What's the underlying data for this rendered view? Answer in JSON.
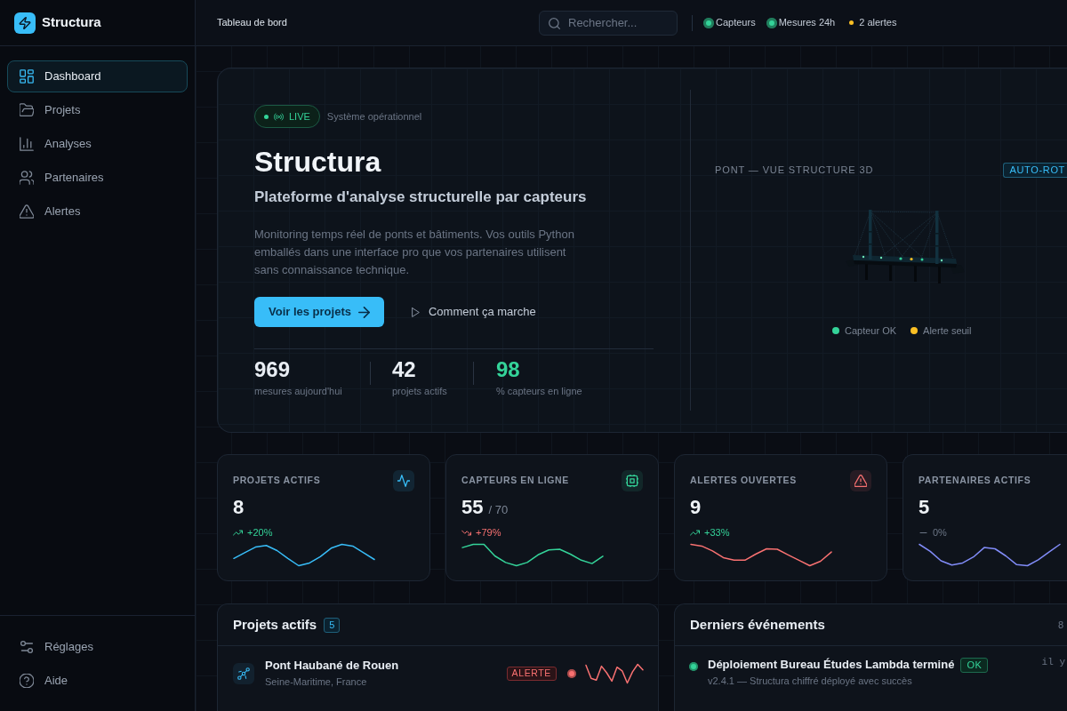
{
  "app": {
    "name": "Structura"
  },
  "sidebar": {
    "items": [
      {
        "label": "Dashboard",
        "selected": true
      },
      {
        "label": "Projets",
        "selected": false
      },
      {
        "label": "Analyses",
        "selected": false
      },
      {
        "label": "Partenaires",
        "selected": false
      },
      {
        "label": "Alertes",
        "selected": false
      }
    ],
    "footer_items": [
      {
        "label": "Réglages"
      },
      {
        "label": "Aide"
      }
    ]
  },
  "header": {
    "title": "Tableau de bord",
    "search": {
      "placeholder": "Rechercher..."
    },
    "status": [
      {
        "label": "Capteurs",
        "kind": "pulse",
        "color": "#34d399"
      },
      {
        "label": "Mesures 24h",
        "kind": "pulse",
        "color": "#34d399"
      },
      {
        "label": "2 alertes",
        "kind": "dot",
        "color": "#fbbf24"
      }
    ]
  },
  "hero": {
    "badge": "LIVE",
    "status_text": "Système opérationnel",
    "title": "Structura",
    "subtitle": "Plateforme d'analyse structurelle par capteurs",
    "description": "Monitoring temps réel de ponts et bâtiments. Vos outils Python emballés dans une interface pro que vos partenaires utilisent sans connaissance technique.",
    "buttons": [
      {
        "label": "Voir les projets",
        "kind": "primary"
      },
      {
        "label": "Comment ça marche",
        "kind": "ghost"
      }
    ],
    "stats": [
      {
        "value": "969",
        "label": "mesures aujourd'hui",
        "color": "#e8edf3"
      },
      {
        "value": "42",
        "label": "projets actifs",
        "color": "#e8edf3"
      },
      {
        "value": "98",
        "label": "% capteurs en ligne",
        "color": "#34d399"
      }
    ],
    "viewer": {
      "title": "PONT — VUE STRUCTURE 3D",
      "badge": "AUTO-ROT",
      "legend": [
        {
          "label": "Capteur OK",
          "color": "#34d399"
        },
        {
          "label": "Alerte seuil",
          "color": "#fbbf24"
        }
      ]
    }
  },
  "kpis": [
    {
      "label": "PROJETS ACTIFS",
      "value": "8",
      "change": "+20%",
      "kind": "up",
      "color": "#38bdf8"
    },
    {
      "label": "CAPTEURS EN LIGNE",
      "value": "55",
      "total": "/ 70",
      "change": "+79%",
      "kind": "down",
      "color": "#34d399"
    },
    {
      "label": "ALERTES OUVERTES",
      "value": "9",
      "change": "+33%",
      "kind": "up",
      "color": "#f87171"
    },
    {
      "label": "PARTENAIRES ACTIFS",
      "value": "5",
      "change": "0%",
      "kind": "flat",
      "color": "#818cf8"
    }
  ],
  "projects": {
    "title": "Projets actifs",
    "count": "5",
    "rows": [
      {
        "name": "Pont Haubané de Rouen",
        "location": "Seine-Maritime, France",
        "status": {
          "label": "ALERTE",
          "kind": "alert"
        },
        "color": "#f87171"
      }
    ]
  },
  "events": {
    "title": "Derniers événements",
    "count": "8",
    "items": [
      {
        "title": "Déploiement Bureau Études Lambda terminé",
        "badge": {
          "label": "OK",
          "kind": "ok"
        },
        "detail": "v2.4.1 — Structura chiffré déployé avec succès",
        "time": "il y",
        "color": "#34d399"
      }
    ]
  }
}
